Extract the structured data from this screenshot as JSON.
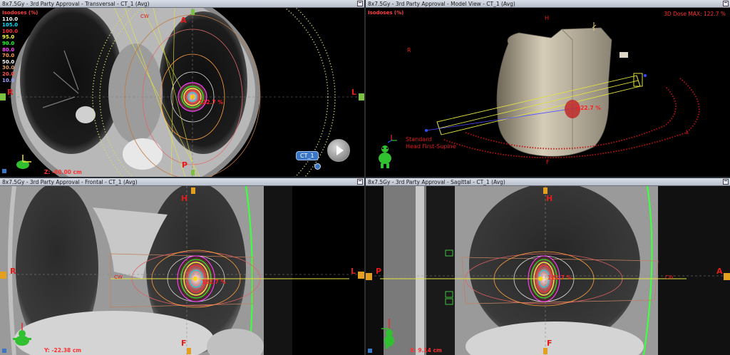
{
  "viewports": {
    "transversal": {
      "title": "8x7.5Gy  -  3rd Party Approval  -  Transversal  -  CT_1 (Avg)",
      "legend_title": "Isodoses (%)",
      "legend": [
        {
          "value": "110.0",
          "color": "#ffffff"
        },
        {
          "value": "105.0",
          "color": "#00e0ff"
        },
        {
          "value": "100.0",
          "color": "#ff3030"
        },
        {
          "value": "95.0",
          "color": "#ffff40"
        },
        {
          "value": "90.0",
          "color": "#20ff20"
        },
        {
          "value": "80.0",
          "color": "#ff40ff"
        },
        {
          "value": "70.0",
          "color": "#ffa040"
        },
        {
          "value": "50.0",
          "color": "#ffffff"
        },
        {
          "value": "30.0",
          "color": "#e0a060"
        },
        {
          "value": "20.0",
          "color": "#ff5050"
        },
        {
          "value": "10.0",
          "color": "#a0a0ff"
        }
      ],
      "orient": {
        "anterior": "A",
        "posterior": "P",
        "left": "L",
        "right": "R"
      },
      "beam_label": "CW",
      "coord": "Z: -80.00 cm",
      "dose_label": "122.7 %",
      "ct_badge": "CT_1",
      "info_icon": "info-icon",
      "play_icon": "play-icon"
    },
    "model": {
      "title": "8x7.5Gy  -  3rd Party Approval  -  Model View  -  CT_1 (Avg)",
      "legend_title": "Isodoses (%)",
      "dose_max": "3D Dose MAX: 122.7 %",
      "orient": {
        "head": "H",
        "feet": "F",
        "right": "R",
        "left": "L"
      },
      "position_label_1": "Standard",
      "position_label_2": "Head First-Supine",
      "dose_label": "122.7 %"
    },
    "frontal": {
      "title": "8x7.5Gy  -  3rd Party Approval  -  Frontal  -  CT_1 (Avg)",
      "orient": {
        "head": "H",
        "feet": "F",
        "right": "R",
        "left": "L"
      },
      "beam_label": "CW",
      "dose_label": "122.7 %",
      "coord": "Y: -22.38 cm"
    },
    "sagittal": {
      "title": "8x7.5Gy  -  3rd Party Approval  -  Sagittal  -  CT_1 (Avg)",
      "orient": {
        "head": "H",
        "feet": "F",
        "posterior": "P",
        "anterior": "A"
      },
      "beam_label": "CW",
      "dose_label": "122.7 %",
      "coord": "X: 9.14 cm"
    }
  },
  "colors": {
    "isodose_red": "#ff3030",
    "isodose_yellow": "#ffff40",
    "isodose_orange": "#ffa040",
    "isodose_green": "#20ff20",
    "isodose_magenta": "#ff40ff",
    "body_contour": "#40ff40",
    "orient_red": "#e31b1b"
  }
}
